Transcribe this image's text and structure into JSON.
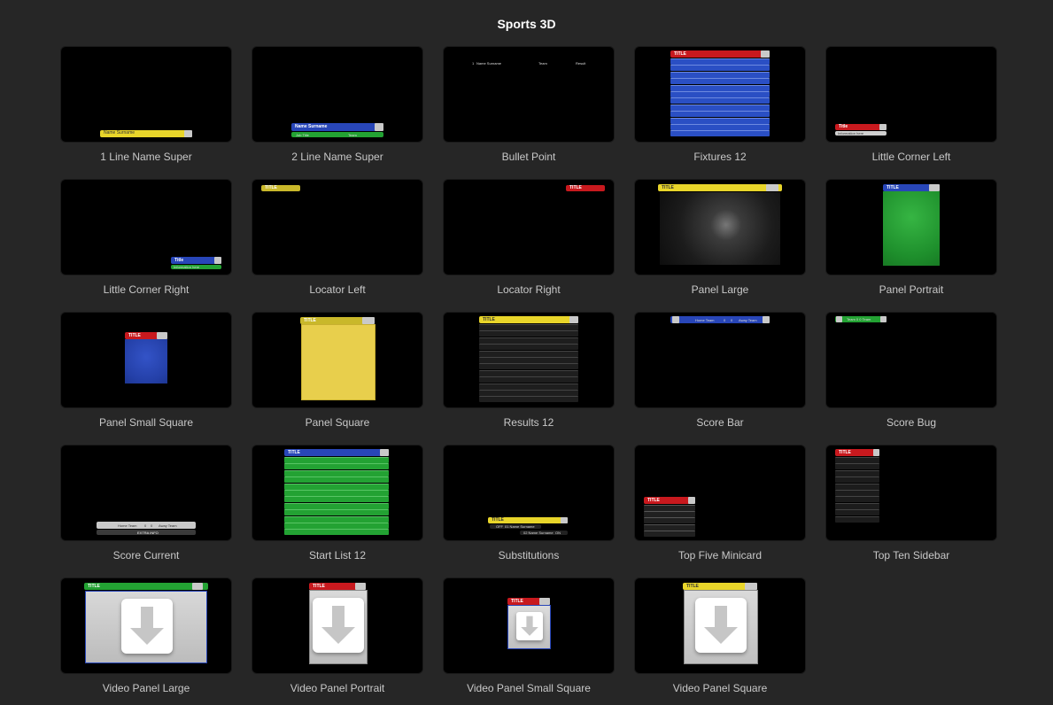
{
  "window": {
    "title": "Sports 3D"
  },
  "colors": {
    "background": "#262626",
    "yellow": "#e8d52a",
    "blue": "#2846b8",
    "red": "#c8191e",
    "green": "#23a233",
    "thumbnail": "#000000",
    "label": "#c8c8c8"
  },
  "templates": [
    {
      "label": "1 Line Name Super",
      "texts": [
        "Name Surname"
      ]
    },
    {
      "label": "2 Line Name Super",
      "texts": [
        "Name Surname",
        "Job Title",
        "Team"
      ]
    },
    {
      "label": "Bullet Point",
      "texts": [
        "1",
        "Name Surname",
        "Team",
        "Result"
      ]
    },
    {
      "label": "Fixtures 12",
      "texts": [
        "TITLE",
        "Home Team",
        "V",
        "Away Team"
      ]
    },
    {
      "label": "Little Corner Left",
      "texts": [
        "Title",
        "Information here"
      ]
    },
    {
      "label": "Little Corner Right",
      "texts": [
        "Title",
        "Information here"
      ]
    },
    {
      "label": "Locator Left",
      "texts": [
        "TITLE"
      ]
    },
    {
      "label": "Locator Right",
      "texts": [
        "TITLE"
      ]
    },
    {
      "label": "Panel Large",
      "texts": [
        "TITLE"
      ]
    },
    {
      "label": "Panel Portrait",
      "texts": [
        "TITLE"
      ]
    },
    {
      "label": "Panel Small Square",
      "texts": [
        "TITLE"
      ]
    },
    {
      "label": "Panel Square",
      "texts": [
        "TITLE"
      ]
    },
    {
      "label": "Results 12",
      "texts": [
        "TITLE",
        "Home Team",
        "0",
        "0",
        "Away Team"
      ]
    },
    {
      "label": "Score Bar",
      "texts": [
        "Home Team",
        "0",
        "0",
        "Away Team"
      ]
    },
    {
      "label": "Score Bug",
      "texts": [
        "Team 0 0 Team"
      ]
    },
    {
      "label": "Score Current",
      "texts": [
        "Home Team",
        "0",
        "0",
        "Away Team",
        "EXTRA INFO"
      ]
    },
    {
      "label": "Start List 12",
      "texts": [
        "TITLE",
        "Name Surname",
        "Team"
      ]
    },
    {
      "label": "Substitutions",
      "texts": [
        "TITLE",
        "OFF",
        "01 Name Surname",
        "02 Name Surname",
        "ON"
      ]
    },
    {
      "label": "Top Five Minicard",
      "texts": [
        "TITLE",
        "Name Surname",
        "Result"
      ]
    },
    {
      "label": "Top Ten Sidebar",
      "texts": [
        "TITLE",
        "Name Surname"
      ]
    },
    {
      "label": "Video Panel Large",
      "texts": [
        "TITLE"
      ]
    },
    {
      "label": "Video Panel Portrait",
      "texts": [
        "TITLE"
      ]
    },
    {
      "label": "Video Panel Small Square",
      "texts": [
        "TITLE"
      ]
    },
    {
      "label": "Video Panel Square",
      "texts": [
        "TITLE"
      ]
    }
  ]
}
